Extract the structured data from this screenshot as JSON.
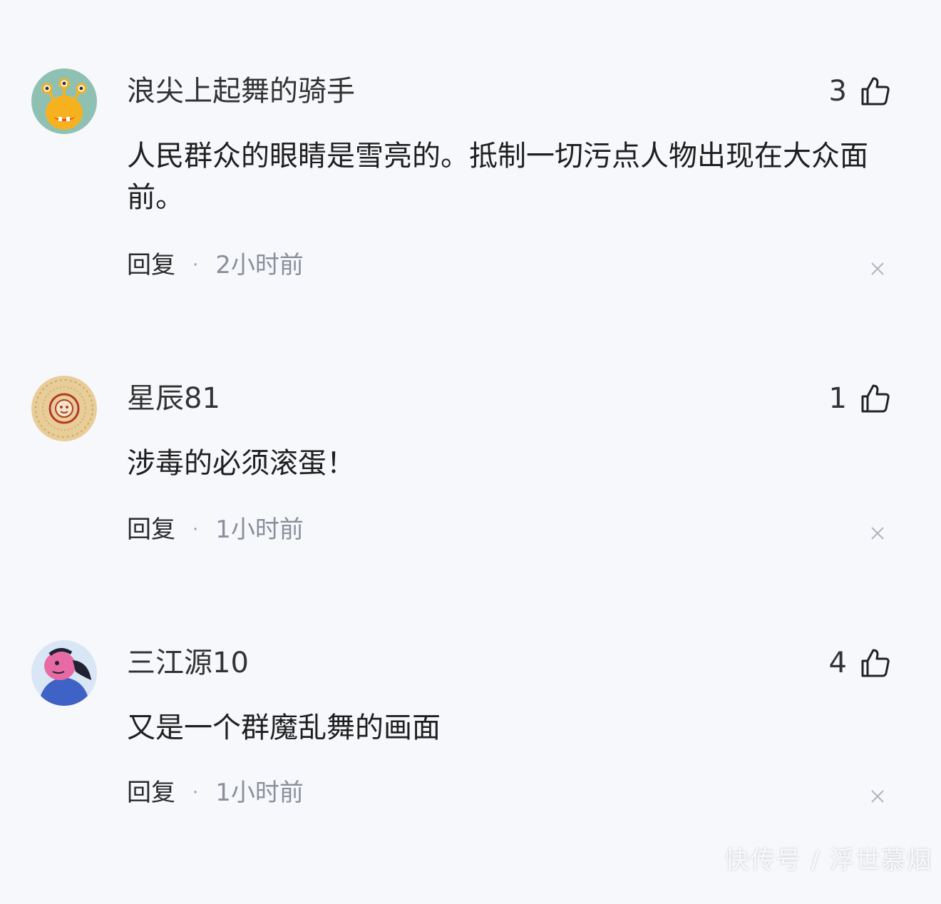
{
  "comments": [
    {
      "username": "浪尖上起舞的骑手",
      "likes": "3",
      "text": "人民群众的眼睛是雪亮的。抵制一切污点人物出现在大众面前。",
      "reply_label": "回复",
      "separator": "·",
      "time": "2小时前",
      "avatar_icon": "monster-avatar"
    },
    {
      "username": "星辰81",
      "likes": "1",
      "text": "涉毒的必须滚蛋！",
      "reply_label": "回复",
      "separator": "·",
      "time": "1小时前",
      "avatar_icon": "ornament-avatar"
    },
    {
      "username": "三江源10",
      "likes": "4",
      "text": "又是一个群魔乱舞的画面",
      "reply_label": "回复",
      "separator": "·",
      "time": "1小时前",
      "avatar_icon": "cartoon-person-avatar"
    }
  ],
  "watermark": "快传号 / 浮世慕烟",
  "colors": {
    "background": "#f7f8fc",
    "text": "#1f1f1f",
    "secondary_text": "#8a8f99"
  }
}
